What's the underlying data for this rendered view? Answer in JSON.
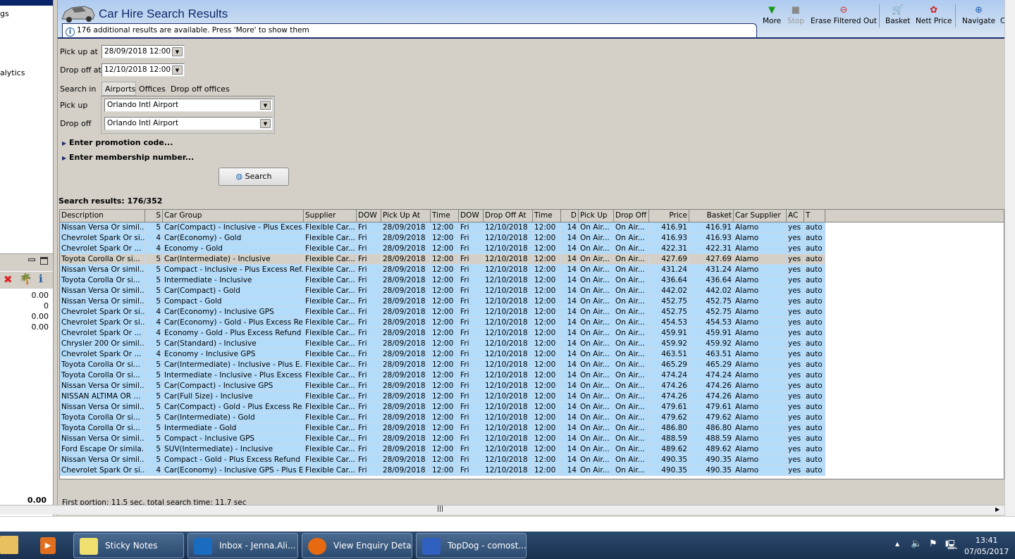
{
  "sidebar": {
    "items": [
      "gs",
      "alytics"
    ],
    "values": [
      "0.00",
      "0",
      "0.00",
      "0.00"
    ],
    "total": "0.00"
  },
  "header": {
    "title": "Car Hire Search Results",
    "info": "176 additional results are available. Press 'More' to show them"
  },
  "toolbar": [
    {
      "label": "More",
      "icon": "triangle-down-icon"
    },
    {
      "label": "Stop",
      "icon": "stop-icon"
    },
    {
      "label": "Erase Filtered Out",
      "icon": "erase-icon"
    },
    {
      "label": "Basket",
      "icon": "basket-icon"
    },
    {
      "label": "Nett Price",
      "icon": "nett-price-icon"
    },
    {
      "label": "Navigate",
      "icon": "navigate-icon"
    },
    {
      "label": "C"
    }
  ],
  "form": {
    "pickup_at_label": "Pick up at",
    "pickup_at": "28/09/2018 12:00",
    "dropoff_at_label": "Drop off at",
    "dropoff_at": "12/10/2018 12:00",
    "search_in_label": "Search in",
    "search_in_tabs": [
      "Airports",
      "Offices",
      "Drop off offices"
    ],
    "pickup_label": "Pick up",
    "pickup": "Orlando Intl Airport",
    "dropoff_label": "Drop off",
    "dropoff": "Orlando Intl Airport",
    "promo": "Enter promotion code...",
    "membership": "Enter membership number...",
    "search_button": "Search"
  },
  "results": {
    "summary": "Search results: 176/352",
    "columns": [
      "Description",
      "S",
      "Car Group",
      "Supplier",
      "DOW",
      "Pick Up At",
      "Time",
      "DOW",
      "Drop Off At",
      "Time",
      "D",
      "Pick Up",
      "Drop Off",
      "Price",
      "Basket",
      "Car Supplier",
      "AC",
      "T"
    ],
    "rows": [
      [
        "Nissan Versa Or simil...",
        "5",
        "Car(Compact) - Inclusive - Plus Exces...",
        "416.91"
      ],
      [
        "Chevrolet Spark Or si...",
        "4",
        "Car(Economy) - Gold",
        "416.93"
      ],
      [
        "Chevrolet  Spark Or ...",
        "4",
        "Economy - Gold",
        "422.31"
      ],
      [
        "Toyota Corolla Or si...",
        "5",
        "Car(Intermediate) - Inclusive",
        "427.69"
      ],
      [
        "Nissan Versa Or simil...",
        "5",
        "Compact - Inclusive - Plus Excess Ref...",
        "431.24"
      ],
      [
        "Toyota Corolla Or si...",
        "5",
        "Intermediate - Inclusive",
        "436.64"
      ],
      [
        "Nissan Versa Or simil...",
        "5",
        "Car(Compact) - Gold",
        "442.02"
      ],
      [
        "Nissan Versa Or simil...",
        "5",
        "Compact - Gold",
        "452.75"
      ],
      [
        "Chevrolet Spark Or si...",
        "4",
        "Car(Economy) - Inclusive GPS",
        "452.75"
      ],
      [
        "Chevrolet Spark Or si...",
        "4",
        "Car(Economy) - Gold - Plus Excess Re...",
        "454.53"
      ],
      [
        "Chevrolet  Spark Or ...",
        "4",
        "Economy - Gold - Plus Excess Refund",
        "459.91"
      ],
      [
        "Chrysler 200 Or simil...",
        "5",
        "Car(Standard) - Inclusive",
        "459.92"
      ],
      [
        "Chevrolet  Spark Or ...",
        "4",
        "Economy - Inclusive GPS",
        "463.51"
      ],
      [
        "Toyota Corolla Or si...",
        "5",
        "Car(Intermediate) - Inclusive - Plus E...",
        "465.29"
      ],
      [
        "Toyota Corolla Or si...",
        "5",
        "Intermediate - Inclusive - Plus Excess ...",
        "474.24"
      ],
      [
        "Nissan Versa Or simil...",
        "5",
        "Car(Compact) - Inclusive GPS",
        "474.26"
      ],
      [
        "NISSAN ALTIMA OR ...",
        "5",
        "Car(Full Size) - Inclusive",
        "474.26"
      ],
      [
        "Nissan Versa Or simil...",
        "5",
        "Car(Compact) - Gold - Plus Excess Re...",
        "479.61"
      ],
      [
        "Toyota Corolla Or si...",
        "5",
        "Car(Intermediate) - Gold",
        "479.62"
      ],
      [
        "Toyota Corolla Or si...",
        "5",
        "Intermediate - Gold",
        "486.80"
      ],
      [
        "Nissan Versa Or simil...",
        "5",
        "Compact - Inclusive GPS",
        "488.59"
      ],
      [
        "Ford Escape Or simila...",
        "5",
        "SUV(Intermediate) - Inclusive",
        "489.62"
      ],
      [
        "Nissan Versa Or simil...",
        "5",
        "Compact - Gold - Plus Excess Refund",
        "490.35"
      ],
      [
        "Chevrolet Spark Or si...",
        "4",
        "Car(Economy) - Inclusive GPS - Plus E...",
        "490.35"
      ]
    ],
    "common": {
      "supplier": "Flexible Car...",
      "dow_pick": "Fri",
      "pickup_at": "28/09/2018",
      "time": "12:00",
      "dow_drop": "Fri",
      "dropoff_at": "12/10/2018",
      "days": "14",
      "pickup": "On Air...",
      "dropoff": "On Air...",
      "car_supplier": "Alamo",
      "ac": "yes",
      "trans": "auto"
    },
    "selected_row": 3,
    "status": "First portion: 11.5 sec, total search time: 11.7 sec"
  },
  "taskbar": {
    "tasks": [
      "Sticky Notes",
      "Inbox - Jenna.Ali...",
      "View Enquiry Deta...",
      "TopDog - comost..."
    ],
    "time": "13:41",
    "date": "07/05/2017"
  },
  "colors": {
    "row": "#b3dcfb",
    "selected": "#d4d0c8",
    "title": "#0f2a6a"
  }
}
